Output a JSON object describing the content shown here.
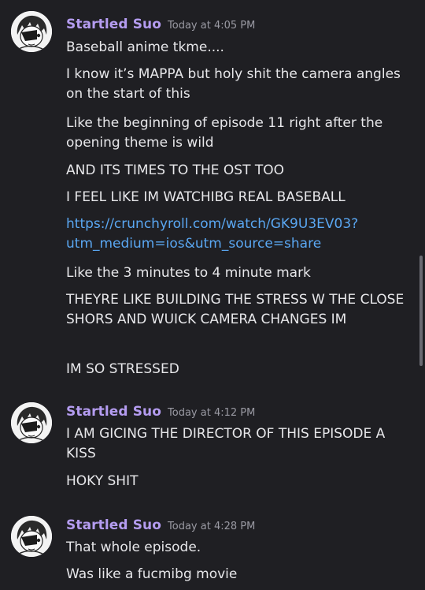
{
  "groups": [
    {
      "author": "Startled Suo",
      "timestamp": "Today at 4:05 PM",
      "messages": [
        {
          "text": "Baseball anime tkme...."
        },
        {
          "text": "I know it’s MAPPA but holy shit the camera angles on the start of this"
        },
        {
          "text": "Like the beginning of episode 11 right after the opening theme is wild"
        },
        {
          "text": "AND ITS TIMES TO THE OST TOO"
        },
        {
          "text": "I FEEL LIKE IM WATCHIBG REAL BASEBALL"
        },
        {
          "text": "https://crunchyroll.com/watch/GK9U3EV03?utm_medium=ios&utm_source=share",
          "is_link": true
        },
        {
          "text": "Like the 3 minutes to 4 minute mark"
        },
        {
          "text": "THEYRE LIKE BUILDING THE STRESS W THE CLOSE SHORS AND WUICK CAMERA CHANGES IM"
        },
        {
          "text": "IM SO STRESSED"
        }
      ]
    },
    {
      "author": "Startled Suo",
      "timestamp": "Today at 4:12 PM",
      "messages": [
        {
          "text": "I AM GICING THE DIRECTOR OF THIS EPISODE A KISS"
        },
        {
          "text": "HOKY SHIT"
        }
      ]
    },
    {
      "author": "Startled Suo",
      "timestamp": "Today at 4:28 PM",
      "messages": [
        {
          "text": "That whole episode."
        },
        {
          "text": "Was like a fucmibg movie"
        }
      ]
    }
  ],
  "colors": {
    "background": "#1f1f23",
    "username": "#b49cf0",
    "link": "#5aa7f2",
    "text": "#e7e7ea",
    "timestamp": "#9a9aa3"
  },
  "avatar_icon": "anime-character-avatar-icon"
}
